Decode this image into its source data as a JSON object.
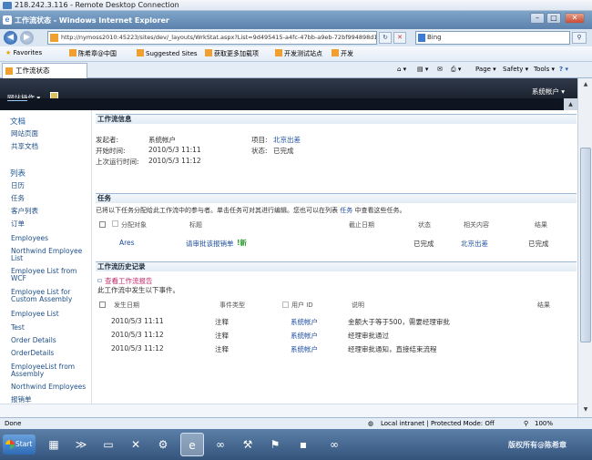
{
  "rdp": {
    "title": "218.242.3.116 - Remote Desktop Connection"
  },
  "ie": {
    "window_title": "工作流状态 - Windows Internet Explorer",
    "controls": {
      "minimize": "–",
      "maximize": "□",
      "close": "✕"
    },
    "address": "http://nymoss2010:45223/sites/dev/_layouts/WrkStat.aspx?List=9d495415-a4fc-47bb-a9eb-72bf994898d18Wor",
    "search_placeholder": "Bing",
    "favorites_label": "Favorites",
    "favorites": [
      "陈希章@中国",
      "Suggested Sites",
      "获取更多加载项",
      "开发测试站点",
      "开发"
    ],
    "tab_title": "工作流状态",
    "tools": {
      "page": "Page",
      "safety": "Safety",
      "tools": "Tools",
      "help": "?"
    }
  },
  "sharepoint": {
    "site_actions": "网站操作",
    "account": "系统帐户"
  },
  "leftnav": {
    "docs_header": "文档",
    "docs_items": [
      "网站页面",
      "共享文档"
    ],
    "lists_header": "列表",
    "lists_items": [
      "日历",
      "任务",
      "客户列表",
      "订单",
      "Employees",
      "Northwind Employee List",
      "Employee List from WCF",
      "Employee List for Custom Assembly",
      "Employee List",
      "Test",
      "Order Details",
      "OrderDetails",
      "EmployeeList from Assembly",
      "Northwind Employees",
      "报销单"
    ]
  },
  "info": {
    "header": "工作流信息",
    "initiator_label": "发起者:",
    "initiator": "系统帐户",
    "item_label": "项目:",
    "item": "北京出差",
    "started_label": "开始时间:",
    "started": "2010/5/3 11:11",
    "status_label": "状态:",
    "status": "已完成",
    "last_run_label": "上次运行时间:",
    "last_run": "2010/5/3 11:12"
  },
  "tasks": {
    "header": "任务",
    "desc_prefix": "已将以下任务分配给此工作流中的参与者。单击任务可对其进行编辑。您也可以在列表",
    "desc_link": "任务",
    "desc_suffix": "中查看这些任务。",
    "columns": [
      "分配对象",
      "标题",
      "截止日期",
      "状态",
      "相关内容",
      "结果"
    ],
    "rows": [
      {
        "assignee": "Ares",
        "title": "请审批该报销单",
        "new": "!新",
        "due": "",
        "status": "已完成",
        "related": "北京出差",
        "outcome": "已完成"
      }
    ]
  },
  "history": {
    "header": "工作流历史记录",
    "report_link": "查看工作流报告",
    "desc": "此工作流中发生以下事件。",
    "columns": [
      "发生日期",
      "事件类型",
      "用户 ID",
      "说明",
      "结果"
    ],
    "rows": [
      {
        "date": "2010/5/3 11:11",
        "type": "注释",
        "user": "系统帐户",
        "desc": "金额大于等于500，需要经理审批",
        "outcome": ""
      },
      {
        "date": "2010/5/3 11:12",
        "type": "注释",
        "user": "系统帐户",
        "desc": "经理审批通过",
        "outcome": ""
      },
      {
        "date": "2010/5/3 11:12",
        "type": "注释",
        "user": "系统帐户",
        "desc": "经理审批通知，直接结束流程",
        "outcome": ""
      }
    ]
  },
  "statusbar": {
    "status": "Done",
    "zone": "Local intranet | Protected Mode: Off",
    "zoom": "100%"
  },
  "taskbar": {
    "start": "Start",
    "watermark": "版权所有@陈希章"
  }
}
